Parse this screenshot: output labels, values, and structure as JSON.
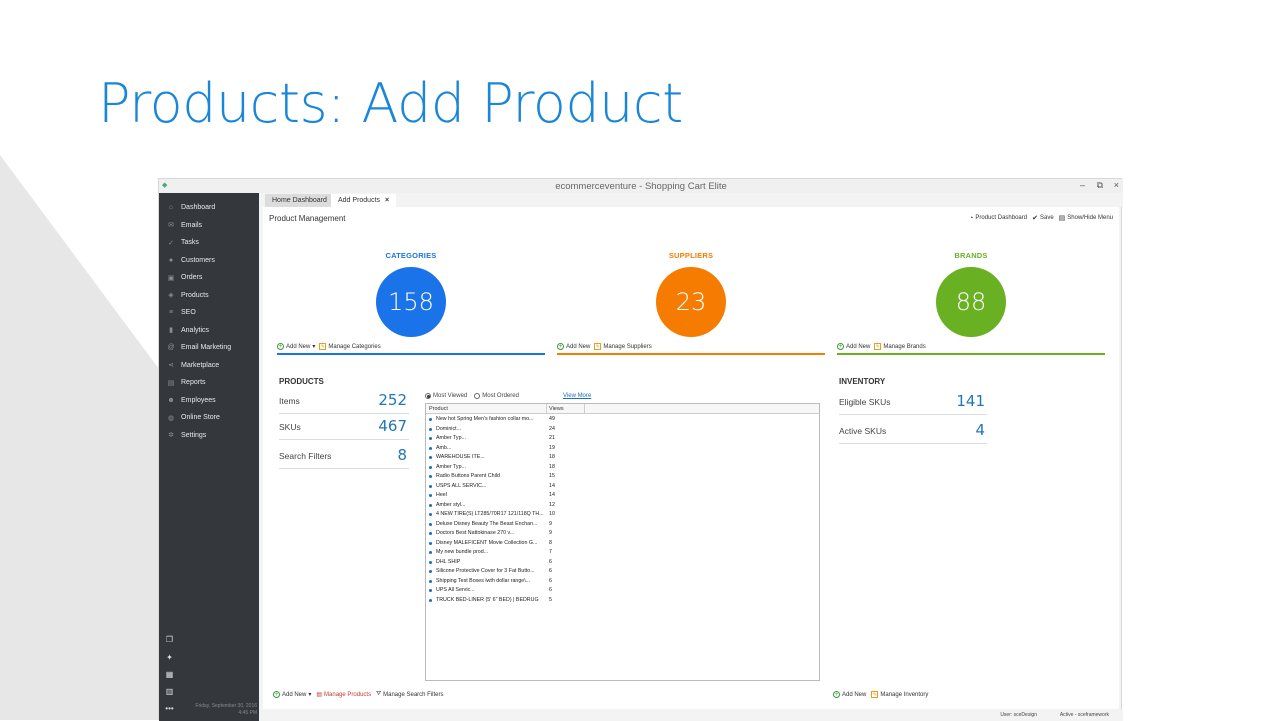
{
  "slide": {
    "title": "Products: Add Product"
  },
  "window": {
    "title": "ecommerceventure - Shopping Cart Elite",
    "minimize": "–",
    "restore": "⧉",
    "close": "×"
  },
  "sidebar": {
    "items": [
      {
        "label": "Dashboard",
        "icon": "home-icon"
      },
      {
        "label": "Emails",
        "icon": "envelope-icon"
      },
      {
        "label": "Tasks",
        "icon": "tasks-icon"
      },
      {
        "label": "Customers",
        "icon": "user-icon"
      },
      {
        "label": "Orders",
        "icon": "cart-icon"
      },
      {
        "label": "Products",
        "icon": "tag-icon"
      },
      {
        "label": "SEO",
        "icon": "seo-icon"
      },
      {
        "label": "Analytics",
        "icon": "bar-chart-icon"
      },
      {
        "label": "Email Marketing",
        "icon": "at-icon"
      },
      {
        "label": "Marketplace",
        "icon": "share-icon"
      },
      {
        "label": "Reports",
        "icon": "report-icon"
      },
      {
        "label": "Employees",
        "icon": "people-icon"
      },
      {
        "label": "Online Store",
        "icon": "globe-icon"
      },
      {
        "label": "Settings",
        "icon": "gear-icon"
      }
    ],
    "date": "Friday, September 30, 2016",
    "time": "4:45 PM",
    "more": "•••"
  },
  "tabs": [
    {
      "label": "Home Dashboard"
    },
    {
      "label": "Add Products",
      "close": "×"
    }
  ],
  "main": {
    "title": "Product Management",
    "toolbar": {
      "dashboard": "Product Dashboard",
      "save": "Save",
      "menu": "Show/Hide Menu"
    },
    "cards": [
      {
        "title": "CATEGORIES",
        "value": "158",
        "color": "#1a73e8",
        "add": "Add New",
        "manage": "Manage Categories"
      },
      {
        "title": "SUPPLIERS",
        "value": "23",
        "color": "#f57c00",
        "add": "Add New",
        "manage": "Manage Suppliers"
      },
      {
        "title": "BRANDS",
        "value": "88",
        "color": "#6ab023",
        "add": "Add New",
        "manage": "Manage Brands"
      }
    ],
    "products": {
      "title": "PRODUCTS",
      "stats": [
        {
          "label": "Items",
          "value": "252"
        },
        {
          "label": "SKUs",
          "value": "467"
        },
        {
          "label": "Search Filters",
          "value": "8"
        }
      ],
      "add": "Add New",
      "manage": "Manage Products",
      "filters": "Manage Search Filters"
    },
    "viewed": {
      "radio1": "Most Viewed",
      "radio2": "Most Ordered",
      "view_more": "View More",
      "col_product": "Product",
      "col_views": "Views",
      "rows": [
        {
          "name": "New hot Spring Men's fashion collar mo...",
          "views": "49"
        },
        {
          "name": "Dominict...",
          "views": "24"
        },
        {
          "name": "Amber Typ...",
          "views": "21"
        },
        {
          "name": "Amb...",
          "views": "19"
        },
        {
          "name": "WAREHOUSE ITE...",
          "views": "18"
        },
        {
          "name": "Amber Typ...",
          "views": "18"
        },
        {
          "name": "Radio Buttons Parent Child",
          "views": "15"
        },
        {
          "name": "USPS ALL SERVIC...",
          "views": "14"
        },
        {
          "name": "Heel",
          "views": "14"
        },
        {
          "name": "Amber styl...",
          "views": "12"
        },
        {
          "name": "4 NEW TIRE(S) LT285/70R17 121/118Q TH...",
          "views": "10"
        },
        {
          "name": "Deluxe Disney Beauty The Beast Enchan...",
          "views": "9"
        },
        {
          "name": "Doctors Best Nattokinase 270 v...",
          "views": "9"
        },
        {
          "name": "Disney MALEFICENT Movie Collection G...",
          "views": "8"
        },
        {
          "name": "My new bundle prod...",
          "views": "7"
        },
        {
          "name": "DHL SHIP",
          "views": "6"
        },
        {
          "name": "Silicone Protective Cover for 3 Fat Butto...",
          "views": "6"
        },
        {
          "name": "Shipping Test Boxes iwth dollar range\\...",
          "views": "6"
        },
        {
          "name": "UPS All Servic...",
          "views": "6"
        },
        {
          "name": "TRUCK BED-LINER (5' 6\" BED) | BEDRUG",
          "views": "5"
        }
      ]
    },
    "inventory": {
      "title": "INVENTORY",
      "stats": [
        {
          "label": "Eligible SKUs",
          "value": "141"
        },
        {
          "label": "Active SKUs",
          "value": "4"
        }
      ],
      "add": "Add New",
      "manage": "Manage Inventory"
    }
  },
  "status": {
    "user": "User: sceDesign",
    "active": "Active - sceframework"
  }
}
